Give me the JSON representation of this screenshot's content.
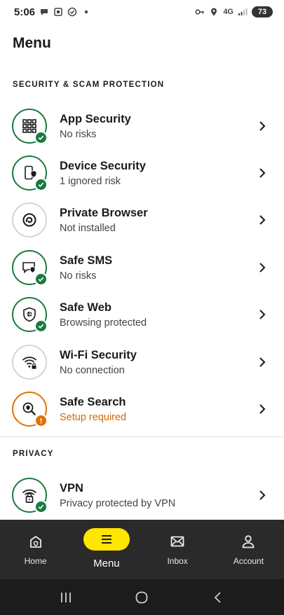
{
  "status_bar": {
    "time": "5:06",
    "network": "4G",
    "battery": "73",
    "icons": [
      "chat-bubble-icon",
      "screenshot-icon",
      "check-circle-icon",
      "dot-icon",
      "vpn-key-icon",
      "location-icon",
      "signal-icon"
    ]
  },
  "page_title": "Menu",
  "sections": {
    "security": "SECURITY & SCAM PROTECTION",
    "privacy": "PRIVACY"
  },
  "menu": {
    "app_security": {
      "title": "App Security",
      "subtitle": "No risks",
      "status": "ok",
      "icon": "app-grid-icon"
    },
    "device_security": {
      "title": "Device Security",
      "subtitle": "1 ignored risk",
      "status": "ok",
      "icon": "phone-shield-icon"
    },
    "private_browser": {
      "title": "Private Browser",
      "subtitle": "Not installed",
      "status": "neutral",
      "icon": "browser-swirl-icon"
    },
    "safe_sms": {
      "title": "Safe SMS",
      "subtitle": "No risks",
      "status": "ok",
      "icon": "message-shield-icon"
    },
    "safe_web": {
      "title": "Safe Web",
      "subtitle": "Browsing protected",
      "status": "ok",
      "icon": "shield-globe-icon"
    },
    "wifi_security": {
      "title": "Wi-Fi Security",
      "subtitle": "No connection",
      "status": "neutral",
      "icon": "wifi-lock-icon"
    },
    "safe_search": {
      "title": "Safe Search",
      "subtitle": "Setup required",
      "status": "warning",
      "icon": "search-shield-icon"
    },
    "vpn": {
      "title": "VPN",
      "subtitle": "Privacy protected by VPN",
      "status": "ok",
      "icon": "wifi-padlock-icon"
    }
  },
  "bottom_nav": {
    "home": "Home",
    "menu": "Menu",
    "inbox": "Inbox",
    "account": "Account",
    "active": "menu"
  },
  "colors": {
    "ok": "#1b7a3e",
    "warning": "#e27100",
    "neutral_border": "#d5d5d5",
    "active_pill": "#ffe600",
    "nav_bg": "#2a2a2a"
  }
}
